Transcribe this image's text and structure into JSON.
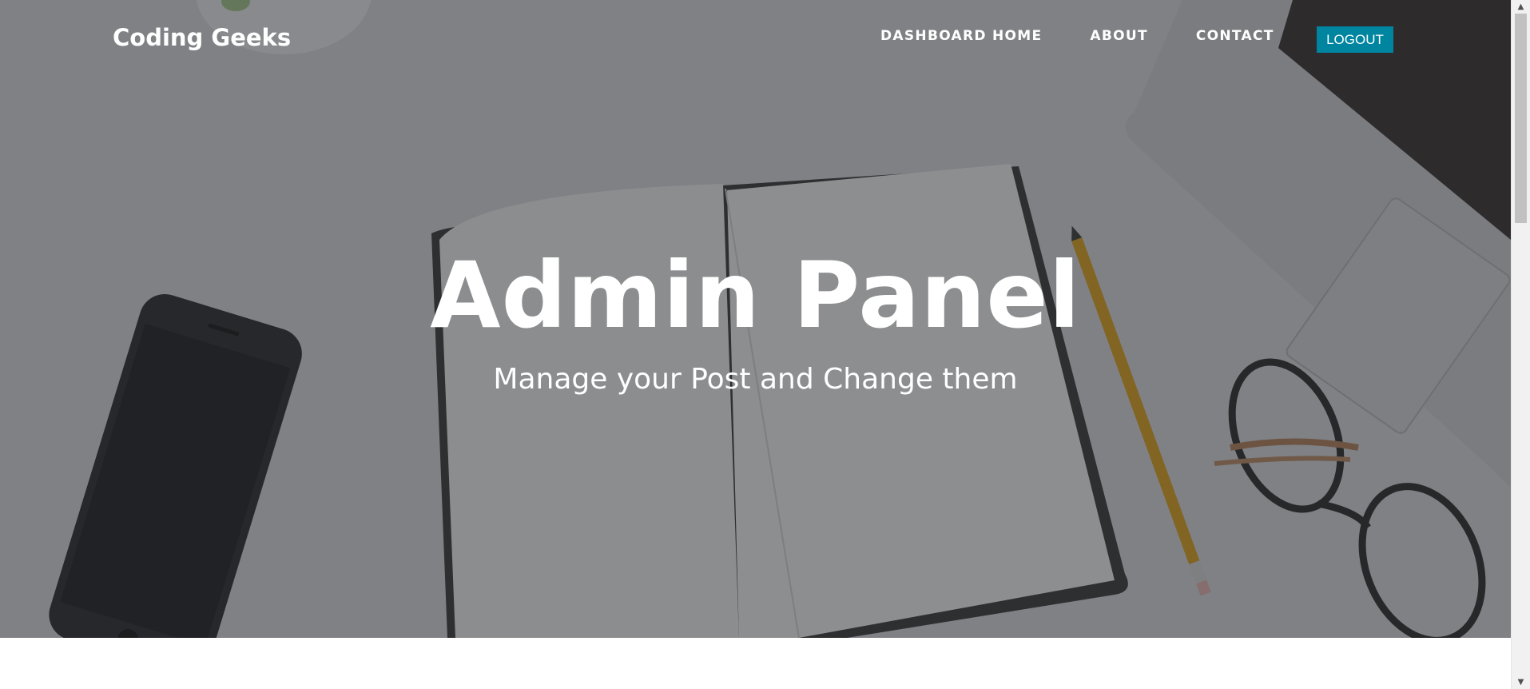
{
  "navbar": {
    "brand": "Coding Geeks",
    "links": [
      "DASHBOARD HOME",
      "ABOUT",
      "CONTACT"
    ],
    "logout_label": "LOGOUT"
  },
  "hero": {
    "title": "Admin Panel",
    "subtitle": "Manage your Post and Change them",
    "background_icon": "desk-photo-background"
  },
  "colors": {
    "accent": "#0085a1",
    "overlay": "#212529",
    "text": "#ffffff"
  },
  "scrollbar": {
    "up_icon": "chevron-up-icon",
    "down_icon": "chevron-down-icon"
  }
}
